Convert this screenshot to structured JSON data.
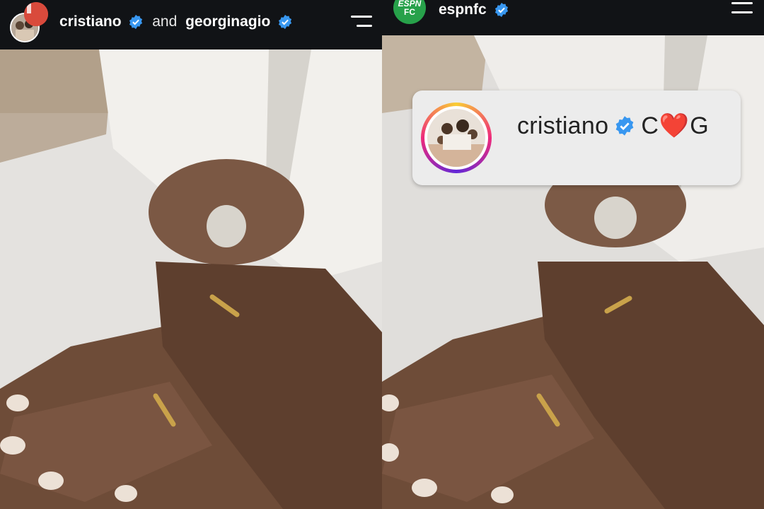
{
  "left_story": {
    "header": {
      "user1": "cristiano",
      "connector": "and",
      "user2": "georginagio",
      "menu_icon": "menu-icon",
      "verified_icon": "verified-badge-icon"
    }
  },
  "right_story": {
    "header": {
      "logo_text_top": "ESPN",
      "logo_text_bottom": "FC",
      "username": "espnfc",
      "menu_icon": "menu-icon",
      "verified_icon": "verified-badge-icon"
    },
    "mention": {
      "username": "cristiano",
      "tag_before": "C",
      "tag_heart": "❤️",
      "tag_after": "G"
    }
  },
  "colors": {
    "header_bg": "#111316",
    "verified_blue": "#3897f0",
    "espn_green": "#27a14a",
    "mention_card_bg": "#ececec"
  }
}
